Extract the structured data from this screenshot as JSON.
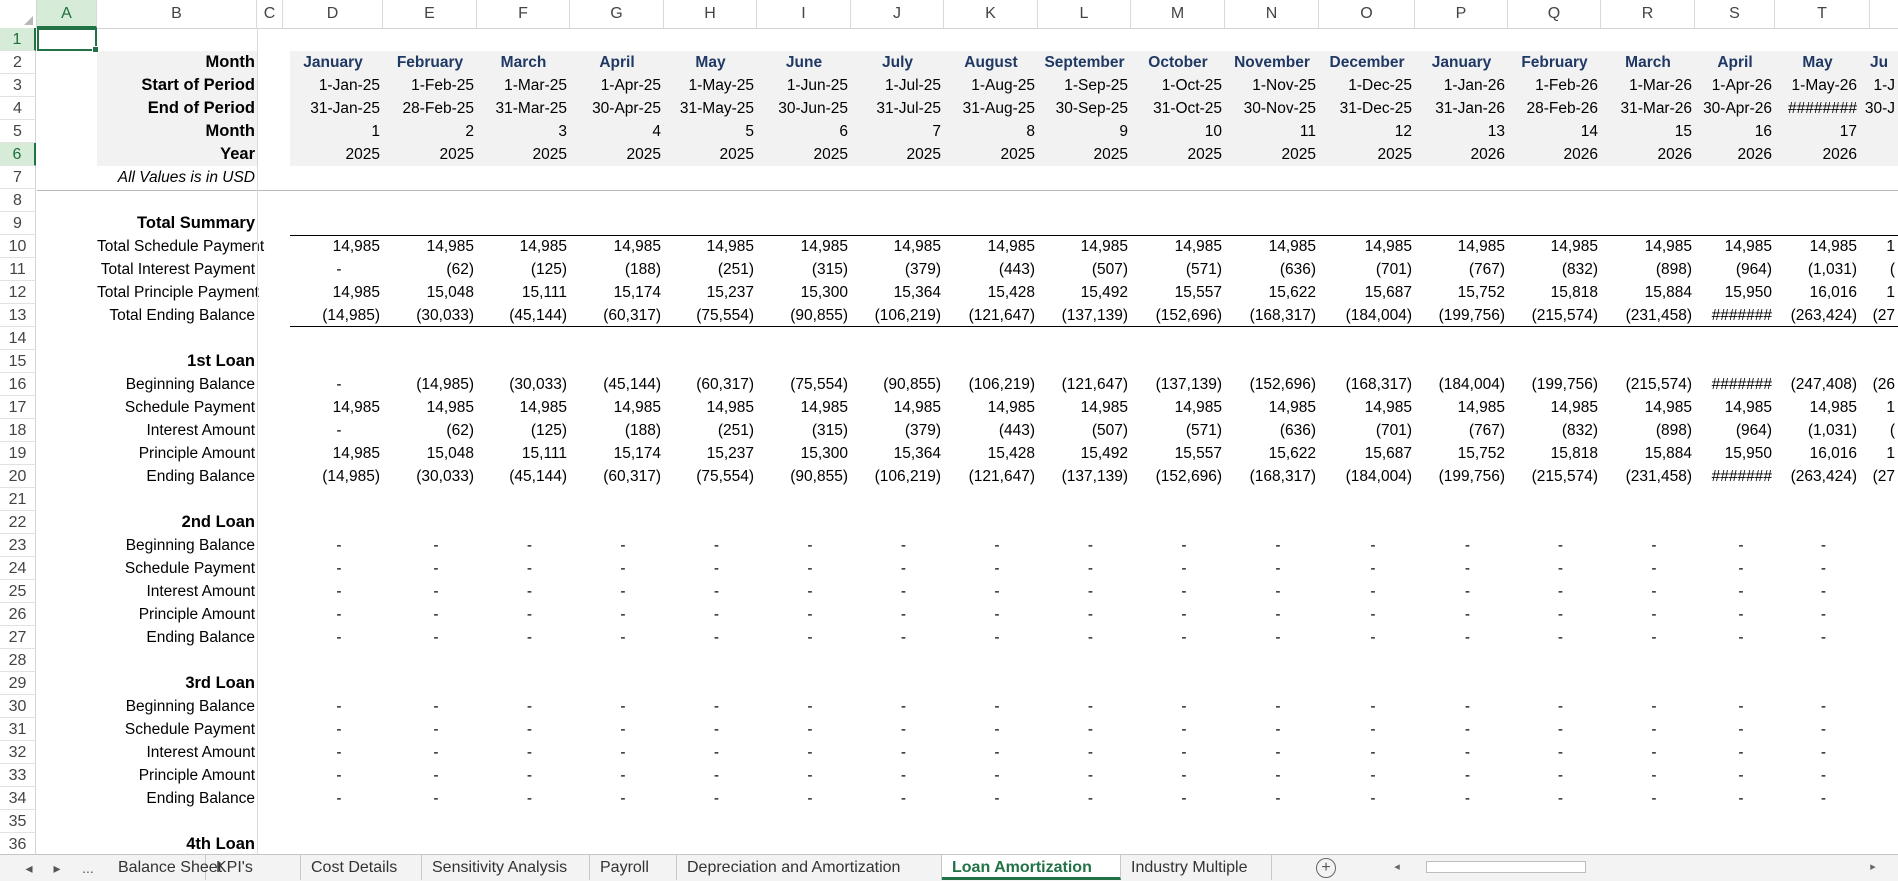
{
  "name_box_cell": "A1",
  "columns": [
    "A",
    "B",
    "C",
    "D",
    "E",
    "F",
    "G",
    "H",
    "I",
    "J",
    "K",
    "L",
    "M",
    "N",
    "O",
    "P",
    "Q",
    "R",
    "S",
    "T"
  ],
  "rows": [
    1,
    2,
    3,
    4,
    5,
    6,
    7,
    8,
    9,
    10,
    11,
    12,
    13,
    14,
    15,
    16,
    17,
    18,
    19,
    20,
    21,
    22,
    23,
    24,
    25,
    26,
    27,
    28,
    29,
    30,
    31,
    32,
    33,
    34,
    35,
    36
  ],
  "header": {
    "labels": {
      "month": "Month",
      "start": "Start of Period",
      "end": "End of Period",
      "month_num": "Month",
      "year": "Year",
      "note": "All Values is in USD"
    },
    "months": [
      "January",
      "February",
      "March",
      "April",
      "May",
      "June",
      "July",
      "August",
      "September",
      "October",
      "November",
      "December",
      "January",
      "February",
      "March",
      "April",
      "May",
      "Ju"
    ],
    "start": [
      "1-Jan-25",
      "1-Feb-25",
      "1-Mar-25",
      "1-Apr-25",
      "1-May-25",
      "1-Jun-25",
      "1-Jul-25",
      "1-Aug-25",
      "1-Sep-25",
      "1-Oct-25",
      "1-Nov-25",
      "1-Dec-25",
      "1-Jan-26",
      "1-Feb-26",
      "1-Mar-26",
      "1-Apr-26",
      "1-May-26",
      "1-J"
    ],
    "end": [
      "31-Jan-25",
      "28-Feb-25",
      "31-Mar-25",
      "30-Apr-25",
      "31-May-25",
      "30-Jun-25",
      "31-Jul-25",
      "31-Aug-25",
      "30-Sep-25",
      "31-Oct-25",
      "30-Nov-25",
      "31-Dec-25",
      "31-Jan-26",
      "28-Feb-26",
      "31-Mar-26",
      "30-Apr-26",
      "########",
      "30-J"
    ],
    "month_num": [
      "1",
      "2",
      "3",
      "4",
      "5",
      "6",
      "7",
      "8",
      "9",
      "10",
      "11",
      "12",
      "13",
      "14",
      "15",
      "16",
      "17",
      ""
    ],
    "year": [
      "2025",
      "2025",
      "2025",
      "2025",
      "2025",
      "2025",
      "2025",
      "2025",
      "2025",
      "2025",
      "2025",
      "2025",
      "2026",
      "2026",
      "2026",
      "2026",
      "2026",
      ""
    ]
  },
  "summary": {
    "title": "Total Summary",
    "rows": [
      {
        "label": "Total Schedule Payment",
        "values": [
          "14,985",
          "14,985",
          "14,985",
          "14,985",
          "14,985",
          "14,985",
          "14,985",
          "14,985",
          "14,985",
          "14,985",
          "14,985",
          "14,985",
          "14,985",
          "14,985",
          "14,985",
          "14,985",
          "14,985",
          "1"
        ]
      },
      {
        "label": "Total Interest Payment",
        "values": [
          "-",
          "(62)",
          "(125)",
          "(188)",
          "(251)",
          "(315)",
          "(379)",
          "(443)",
          "(507)",
          "(571)",
          "(636)",
          "(701)",
          "(767)",
          "(832)",
          "(898)",
          "(964)",
          "(1,031)",
          "("
        ]
      },
      {
        "label": "Total Principle Payment",
        "values": [
          "14,985",
          "15,048",
          "15,111",
          "15,174",
          "15,237",
          "15,300",
          "15,364",
          "15,428",
          "15,492",
          "15,557",
          "15,622",
          "15,687",
          "15,752",
          "15,818",
          "15,884",
          "15,950",
          "16,016",
          "1"
        ]
      },
      {
        "label": "Total Ending Balance",
        "values": [
          "(14,985)",
          "(30,033)",
          "(45,144)",
          "(60,317)",
          "(75,554)",
          "(90,855)",
          "(106,219)",
          "(121,647)",
          "(137,139)",
          "(152,696)",
          "(168,317)",
          "(184,004)",
          "(199,756)",
          "(215,574)",
          "(231,458)",
          "#######",
          "(263,424)",
          "(27"
        ]
      }
    ]
  },
  "loans": [
    {
      "title": "1st Loan",
      "rows": [
        {
          "label": "Beginning Balance",
          "values": [
            "-",
            "(14,985)",
            "(30,033)",
            "(45,144)",
            "(60,317)",
            "(75,554)",
            "(90,855)",
            "(106,219)",
            "(121,647)",
            "(137,139)",
            "(152,696)",
            "(168,317)",
            "(184,004)",
            "(199,756)",
            "(215,574)",
            "#######",
            "(247,408)",
            "(26"
          ]
        },
        {
          "label": "Schedule Payment",
          "values": [
            "14,985",
            "14,985",
            "14,985",
            "14,985",
            "14,985",
            "14,985",
            "14,985",
            "14,985",
            "14,985",
            "14,985",
            "14,985",
            "14,985",
            "14,985",
            "14,985",
            "14,985",
            "14,985",
            "14,985",
            "1"
          ]
        },
        {
          "label": "Interest Amount",
          "values": [
            "-",
            "(62)",
            "(125)",
            "(188)",
            "(251)",
            "(315)",
            "(379)",
            "(443)",
            "(507)",
            "(571)",
            "(636)",
            "(701)",
            "(767)",
            "(832)",
            "(898)",
            "(964)",
            "(1,031)",
            "("
          ]
        },
        {
          "label": "Principle Amount",
          "values": [
            "14,985",
            "15,048",
            "15,111",
            "15,174",
            "15,237",
            "15,300",
            "15,364",
            "15,428",
            "15,492",
            "15,557",
            "15,622",
            "15,687",
            "15,752",
            "15,818",
            "15,884",
            "15,950",
            "16,016",
            "1"
          ]
        },
        {
          "label": "Ending Balance",
          "values": [
            "(14,985)",
            "(30,033)",
            "(45,144)",
            "(60,317)",
            "(75,554)",
            "(90,855)",
            "(106,219)",
            "(121,647)",
            "(137,139)",
            "(152,696)",
            "(168,317)",
            "(184,004)",
            "(199,756)",
            "(215,574)",
            "(231,458)",
            "#######",
            "(263,424)",
            "(27"
          ]
        }
      ]
    },
    {
      "title": "2nd Loan",
      "rows": [
        {
          "label": "Beginning Balance",
          "values": [
            "-",
            "-",
            "-",
            "-",
            "-",
            "-",
            "-",
            "-",
            "-",
            "-",
            "-",
            "-",
            "-",
            "-",
            "-",
            "-",
            "-",
            ""
          ]
        },
        {
          "label": "Schedule Payment",
          "values": [
            "-",
            "-",
            "-",
            "-",
            "-",
            "-",
            "-",
            "-",
            "-",
            "-",
            "-",
            "-",
            "-",
            "-",
            "-",
            "-",
            "-",
            ""
          ]
        },
        {
          "label": "Interest Amount",
          "values": [
            "-",
            "-",
            "-",
            "-",
            "-",
            "-",
            "-",
            "-",
            "-",
            "-",
            "-",
            "-",
            "-",
            "-",
            "-",
            "-",
            "-",
            ""
          ]
        },
        {
          "label": "Principle Amount",
          "values": [
            "-",
            "-",
            "-",
            "-",
            "-",
            "-",
            "-",
            "-",
            "-",
            "-",
            "-",
            "-",
            "-",
            "-",
            "-",
            "-",
            "-",
            ""
          ]
        },
        {
          "label": "Ending Balance",
          "values": [
            "-",
            "-",
            "-",
            "-",
            "-",
            "-",
            "-",
            "-",
            "-",
            "-",
            "-",
            "-",
            "-",
            "-",
            "-",
            "-",
            "-",
            ""
          ]
        }
      ]
    },
    {
      "title": "3rd Loan",
      "rows": [
        {
          "label": "Beginning Balance",
          "values": [
            "-",
            "-",
            "-",
            "-",
            "-",
            "-",
            "-",
            "-",
            "-",
            "-",
            "-",
            "-",
            "-",
            "-",
            "-",
            "-",
            "-",
            ""
          ]
        },
        {
          "label": "Schedule Payment",
          "values": [
            "-",
            "-",
            "-",
            "-",
            "-",
            "-",
            "-",
            "-",
            "-",
            "-",
            "-",
            "-",
            "-",
            "-",
            "-",
            "-",
            "-",
            ""
          ]
        },
        {
          "label": "Interest Amount",
          "values": [
            "-",
            "-",
            "-",
            "-",
            "-",
            "-",
            "-",
            "-",
            "-",
            "-",
            "-",
            "-",
            "-",
            "-",
            "-",
            "-",
            "-",
            ""
          ]
        },
        {
          "label": "Principle Amount",
          "values": [
            "-",
            "-",
            "-",
            "-",
            "-",
            "-",
            "-",
            "-",
            "-",
            "-",
            "-",
            "-",
            "-",
            "-",
            "-",
            "-",
            "-",
            ""
          ]
        },
        {
          "label": "Ending Balance",
          "values": [
            "-",
            "-",
            "-",
            "-",
            "-",
            "-",
            "-",
            "-",
            "-",
            "-",
            "-",
            "-",
            "-",
            "-",
            "-",
            "-",
            "-",
            ""
          ]
        }
      ]
    },
    {
      "title": "4th Loan",
      "rows": []
    }
  ],
  "tabs": {
    "nav_prev": "◂",
    "nav_next": "▸",
    "ellipsis": "...",
    "items": [
      "Balance Sheet",
      "KPI's",
      "Cost Details",
      "Sensitivity Analysis",
      "Payroll",
      "Depreciation and Amortization",
      "Loan Amortization",
      "Industry Multiple"
    ],
    "active": "Loan Amortization",
    "add": "+"
  },
  "colors": {
    "accent": "#217346",
    "month_header": "#1f3864",
    "shade": "#f2f2f2"
  }
}
